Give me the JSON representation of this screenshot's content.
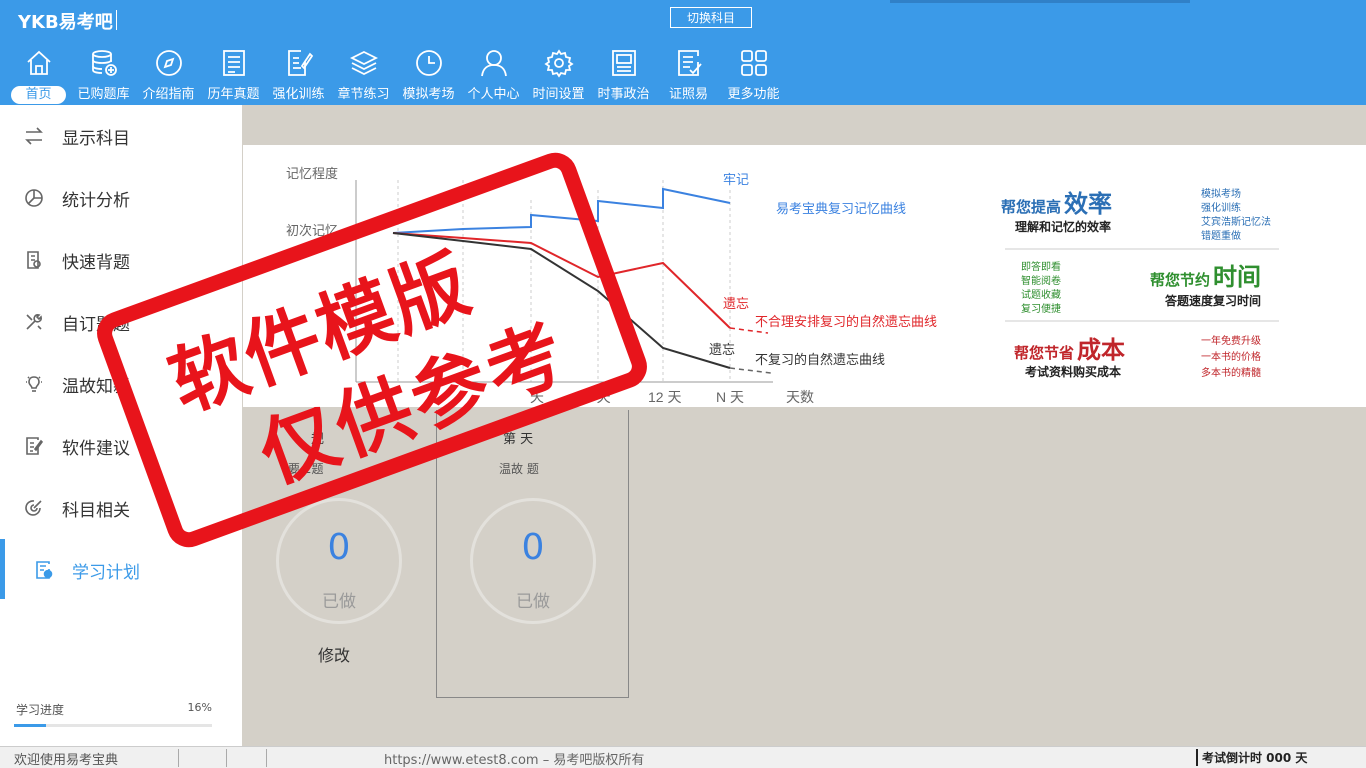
{
  "header": {
    "logo": "YKB易考吧",
    "switch_subject": "切换科目",
    "nav": [
      {
        "label": "首页",
        "icon": "home-icon"
      },
      {
        "label": "已购题库",
        "icon": "database-icon"
      },
      {
        "label": "介绍指南",
        "icon": "compass-icon"
      },
      {
        "label": "历年真题",
        "icon": "document-list-icon"
      },
      {
        "label": "强化训练",
        "icon": "edit-document-icon"
      },
      {
        "label": "章节练习",
        "icon": "layers-icon"
      },
      {
        "label": "模拟考场",
        "icon": "clock-icon"
      },
      {
        "label": "个人中心",
        "icon": "user-icon"
      },
      {
        "label": "时间设置",
        "icon": "gear-icon"
      },
      {
        "label": "时事政治",
        "icon": "newspaper-icon"
      },
      {
        "label": "证照易",
        "icon": "certificate-icon"
      },
      {
        "label": "更多功能",
        "icon": "grid-icon"
      }
    ]
  },
  "sidebar": {
    "items": [
      {
        "label": "显示科目",
        "icon": "swap-icon"
      },
      {
        "label": "统计分析",
        "icon": "pie-chart-icon"
      },
      {
        "label": "快速背题",
        "icon": "quick-review-icon"
      },
      {
        "label": "自订题题",
        "icon": "tools-icon"
      },
      {
        "label": "温故知新",
        "icon": "lightbulb-icon"
      },
      {
        "label": "软件建议",
        "icon": "suggestion-icon"
      },
      {
        "label": "科目相关",
        "icon": "related-icon"
      },
      {
        "label": "学习计划",
        "icon": "plan-icon"
      }
    ],
    "progress_label": "学习进度",
    "progress_value": "16%",
    "progress_fraction": 0.16
  },
  "banner": {
    "y_label": "记忆程度",
    "y_first": "初次记忆",
    "label_firm": "牢记",
    "label_forget_red": "遗忘",
    "label_forget_black": "遗忘",
    "curve_blue": "易考宝典复习记忆曲线",
    "curve_red": "不合理安排复习的自然遗忘曲线",
    "curve_black": "不复习的自然遗忘曲线",
    "ticks": [
      "天",
      "6 天",
      "12 天",
      "N 天",
      "天数"
    ],
    "right_panel": {
      "efficiency_prefix": "帮您提高",
      "efficiency_big": "效率",
      "efficiency_sub": "理解和记忆的效率",
      "efficiency_list": [
        "模拟考场",
        "强化训练",
        "艾宾浩斯记忆法",
        "错题重做"
      ],
      "time_list": [
        "即答即看",
        "智能阅卷",
        "试题收藏",
        "复习便捷"
      ],
      "time_prefix": "帮您节约",
      "time_big": "时间",
      "time_sub": "答题速度复习时间",
      "cost_prefix": "帮您节省",
      "cost_big": "成本",
      "cost_sub": "考试资料购买成本",
      "cost_list": [
        "一年免费升级",
        "一本书的价格",
        "多本书的精髓"
      ]
    }
  },
  "cards": [
    {
      "title": "规",
      "sub": "要   2题",
      "count": "0",
      "done_label": "已做",
      "edit": "修改"
    },
    {
      "title": "第       天",
      "sub": "温故     题",
      "count": "0",
      "done_label": "已做"
    }
  ],
  "stamp": {
    "line1": "软件模版",
    "line2": "仅供参考"
  },
  "statusbar": {
    "welcome": "欢迎使用易考宝典",
    "copyright": "https://www.etest8.com – 易考吧版权所有",
    "timer": "考试倒计时 000 天"
  },
  "colors": {
    "brand_blue": "#3b9ae8",
    "stamp_red": "#e8141b"
  }
}
